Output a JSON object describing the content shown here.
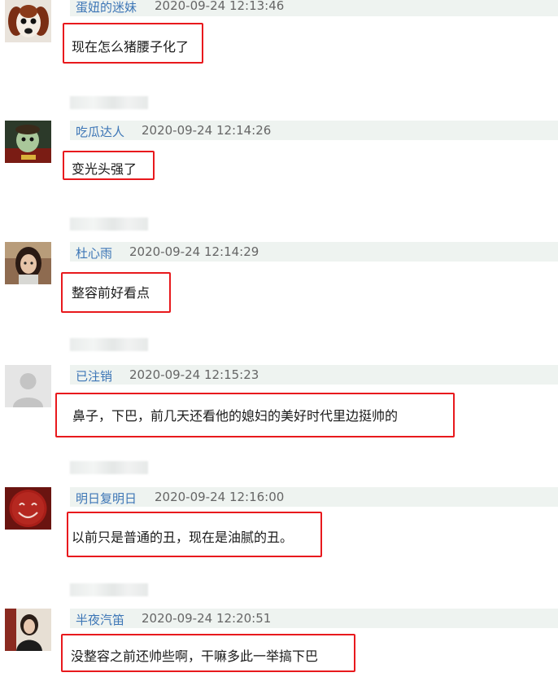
{
  "comments": [
    {
      "user": "蛋妞的迷妹",
      "time": "2020-09-24 12:13:46",
      "text": "现在怎么猪腰子化了",
      "avatar": "dog-avatar"
    },
    {
      "user": "吃瓜达人",
      "time": "2020-09-24 12:14:26",
      "text": "变光头强了",
      "avatar": "cartoon-avatar"
    },
    {
      "user": "杜心雨",
      "time": "2020-09-24 12:14:29",
      "text": "整容前好看点",
      "avatar": "girl-avatar"
    },
    {
      "user": "已注销",
      "time": "2020-09-24 12:15:23",
      "text": "鼻子，下巴，前几天还看他的媳妇的美好时代里边挺帅的",
      "avatar": "default-avatar"
    },
    {
      "user": "明日复明日",
      "time": "2020-09-24 12:16:00",
      "text": "以前只是普通的丑，现在是油腻的丑。",
      "avatar": "smiley-avatar"
    },
    {
      "user": "半夜汽笛",
      "time": "2020-09-24 12:20:51",
      "text": "没整容之前还帅些啊，干嘛多此一举搞下巴",
      "avatar": "woman-avatar"
    }
  ],
  "colors": {
    "highlight": "#e8191d",
    "username": "#3d76b6",
    "header_bg": "#eef3f0"
  }
}
